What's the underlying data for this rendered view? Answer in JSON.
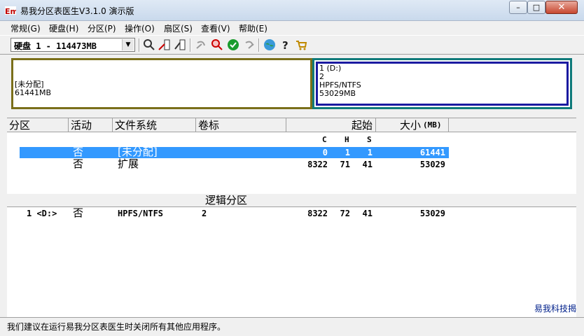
{
  "window": {
    "title": "易我分区表医生V3.1.0 演示版",
    "min": "–",
    "max": "□",
    "close": "✕"
  },
  "menu": [
    "常规(G)",
    "硬盘(H)",
    "分区(P)",
    "操作(O)",
    "扇区(S)",
    "查看(V)",
    "帮助(E)"
  ],
  "toolbar": {
    "disk_select": "硬盘 1 - 114473MB"
  },
  "diskmap": {
    "unallocated": {
      "label": "[未分配]",
      "size": "61441MB"
    },
    "logical": {
      "drive": "1 (D:)",
      "volume": "2",
      "fs": "HPFS/NTFS",
      "size": "53029MB"
    }
  },
  "list": {
    "headers": {
      "partition": "分区",
      "active": "活动",
      "fs": "文件系统",
      "label": "卷标",
      "start": "起始",
      "size": "大小",
      "size_unit": "(MB)"
    },
    "chs": {
      "c": "C",
      "h": "H",
      "s": "S"
    },
    "rows": [
      {
        "partition": "",
        "active": "否",
        "fs": "[未分配]",
        "label": "",
        "c": "0",
        "h": "1",
        "s": "1",
        "size": "61441"
      },
      {
        "partition": "",
        "active": "否",
        "fs": "扩展",
        "label": "",
        "c": "8322",
        "h": "71",
        "s": "41",
        "size": "53029"
      }
    ],
    "logical_title": "逻辑分区",
    "logical_rows": [
      {
        "partition": "1 <D:>",
        "active": "否",
        "fs": "HPFS/NTFS",
        "label": "2",
        "c": "8322",
        "h": "72",
        "s": "41",
        "size": "53029"
      }
    ]
  },
  "footer_link": "易我科技揭",
  "status": "我们建议在运行易我分区表医生时关闭所有其他应用程序。"
}
